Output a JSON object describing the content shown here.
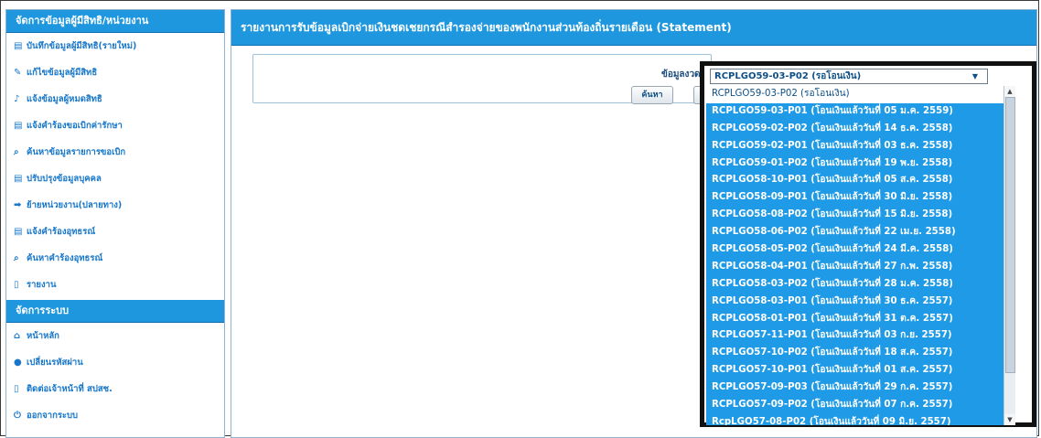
{
  "sidebar": {
    "section1_title": "จัดการข้อมูลผู้มีสิทธิ/หน่วยงาน",
    "items1": [
      {
        "label": "บันทึกข้อมูลผู้มีสิทธิ(รายใหม่)",
        "icon": "form-icon"
      },
      {
        "label": "แก้ไขข้อมูลผู้มีสิทธิ",
        "icon": "pencil-icon"
      },
      {
        "label": "แจ้งข้อมูลผู้หมดสิทธิ",
        "icon": "bell-icon"
      },
      {
        "label": "แจ้งคำร้องขอเบิกค่ารักษา",
        "icon": "form-icon"
      },
      {
        "label": "ค้นหาข้อมูลรายการขอเบิก",
        "icon": "search-icon"
      },
      {
        "label": "ปรับปรุงข้อมูลบุคคล",
        "icon": "form-icon"
      },
      {
        "label": "ย้ายหน่วยงาน(ปลายทาง)",
        "icon": "arrow-icon"
      },
      {
        "label": "แจ้งคำร้องอุทธรณ์",
        "icon": "form-icon"
      },
      {
        "label": "ค้นหาคำร้องอุทธรณ์",
        "icon": "search-icon"
      },
      {
        "label": "รายงาน",
        "icon": "document-icon"
      }
    ],
    "section2_title": "จัดการระบบ",
    "items2": [
      {
        "label": "หน้าหลัก",
        "icon": "home-icon"
      },
      {
        "label": "เปลี่ยนรหัสผ่าน",
        "icon": "lock-icon"
      },
      {
        "label": "ติดต่อเจ้าหน้าที่ สปสช.",
        "icon": "document-icon"
      },
      {
        "label": "ออกจากระบบ",
        "icon": "power-icon"
      }
    ]
  },
  "main": {
    "title": "รายงานการรับข้อมูลเบิกจ่ายเงินชดเชยกรณีสำรองจ่ายของพนักงานส่วนท้องถิ่นรายเดือน (Statement)",
    "filter_label": "ข้อมูลงวดที่",
    "search_button": "ค้นหา"
  },
  "dropdown": {
    "selected": "RCPLGO59-03-P02 (รอโอนเงิน)",
    "options": [
      "RCPLGO59-03-P02 (รอโอนเงิน)",
      "RCPLGO59-03-P01 (โอนเงินแล้ววันที่ 05 ม.ค. 2559)",
      "RCPLGO59-02-P02 (โอนเงินแล้ววันที่ 14 ธ.ค. 2558)",
      "RCPLGO59-02-P01 (โอนเงินแล้ววันที่ 03 ธ.ค. 2558)",
      "RCPLGO59-01-P02 (โอนเงินแล้ววันที่ 19 พ.ย. 2558)",
      "RCPLGO58-10-P01 (โอนเงินแล้ววันที่ 05 ส.ค. 2558)",
      "RCPLGO58-09-P01 (โอนเงินแล้ววันที่ 30 มิ.ย. 2558)",
      "RCPLGO58-08-P02 (โอนเงินแล้ววันที่ 15 มิ.ย. 2558)",
      "RCPLGO58-06-P02 (โอนเงินแล้ววันที่ 22 เม.ย. 2558)",
      "RCPLGO58-05-P02 (โอนเงินแล้ววันที่ 24 มี.ค. 2558)",
      "RCPLGO58-04-P01 (โอนเงินแล้ววันที่ 27 ก.พ. 2558)",
      "RCPLGO58-03-P02 (โอนเงินแล้ววันที่ 28 ม.ค. 2558)",
      "RCPLGO58-03-P01 (โอนเงินแล้ววันที่ 30 ธ.ค. 2557)",
      "RCPLGO58-01-P01 (โอนเงินแล้ววันที่ 31 ต.ค. 2557)",
      "RCPLGO57-11-P01 (โอนเงินแล้ววันที่ 03 ก.ย. 2557)",
      "RCPLGO57-10-P02 (โอนเงินแล้ววันที่ 18 ส.ค. 2557)",
      "RCPLGO57-10-P01 (โอนเงินแล้ววันที่ 01 ส.ค. 2557)",
      "RCPLGO57-09-P03 (โอนเงินแล้ววันที่ 29 ก.ค. 2557)",
      "RCPLGO57-09-P02 (โอนเงินแล้ววันที่ 07 ก.ค. 2557)",
      "RcpLGO57-08-P02 (โอนเงินแล้ววันที่ 09 มิ.ย. 2557)"
    ]
  },
  "colors": {
    "accent": "#1e97df",
    "link": "#1877c9",
    "list_bg": "#1e9ae6"
  }
}
